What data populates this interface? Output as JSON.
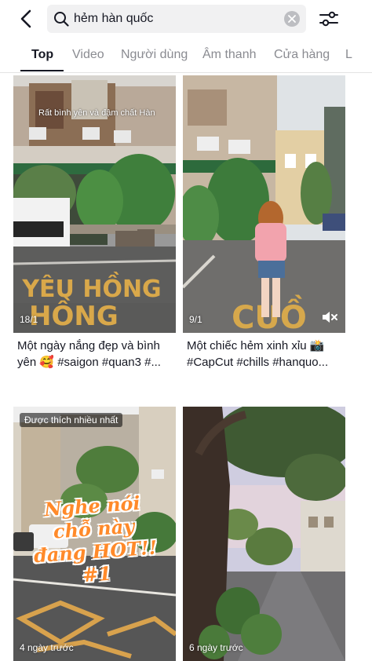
{
  "search": {
    "query": "hẻm hàn quốc"
  },
  "tabs": [
    {
      "label": "Top"
    },
    {
      "label": "Video"
    },
    {
      "label": "Người dùng"
    },
    {
      "label": "Âm thanh"
    },
    {
      "label": "Cửa hàng"
    },
    {
      "label": "L"
    }
  ],
  "videos": [
    {
      "overlay_text": "Rất bình yên và đậm chất Hàn",
      "road_text": "YÊU HỒNG",
      "count": "18/1",
      "caption_line1": "Một ngày nắng đẹp và bình",
      "caption_line2": "yên 🥰 #saigon #quan3 #..."
    },
    {
      "road_text": "CUỒ",
      "count": "9/1",
      "caption_line1": "Một chiếc hẻm xinh xỉu 📸",
      "caption_line2": "#CapCut  #chills #hanquo..."
    },
    {
      "badge": "Được thích nhiều nhất",
      "big_text_1": "Nghe nói",
      "big_text_2": "chỗ này",
      "big_text_3": "đang HOT!!",
      "big_text_4": "#1",
      "time": "4 ngày trước"
    },
    {
      "time": "6 ngày trước"
    }
  ]
}
